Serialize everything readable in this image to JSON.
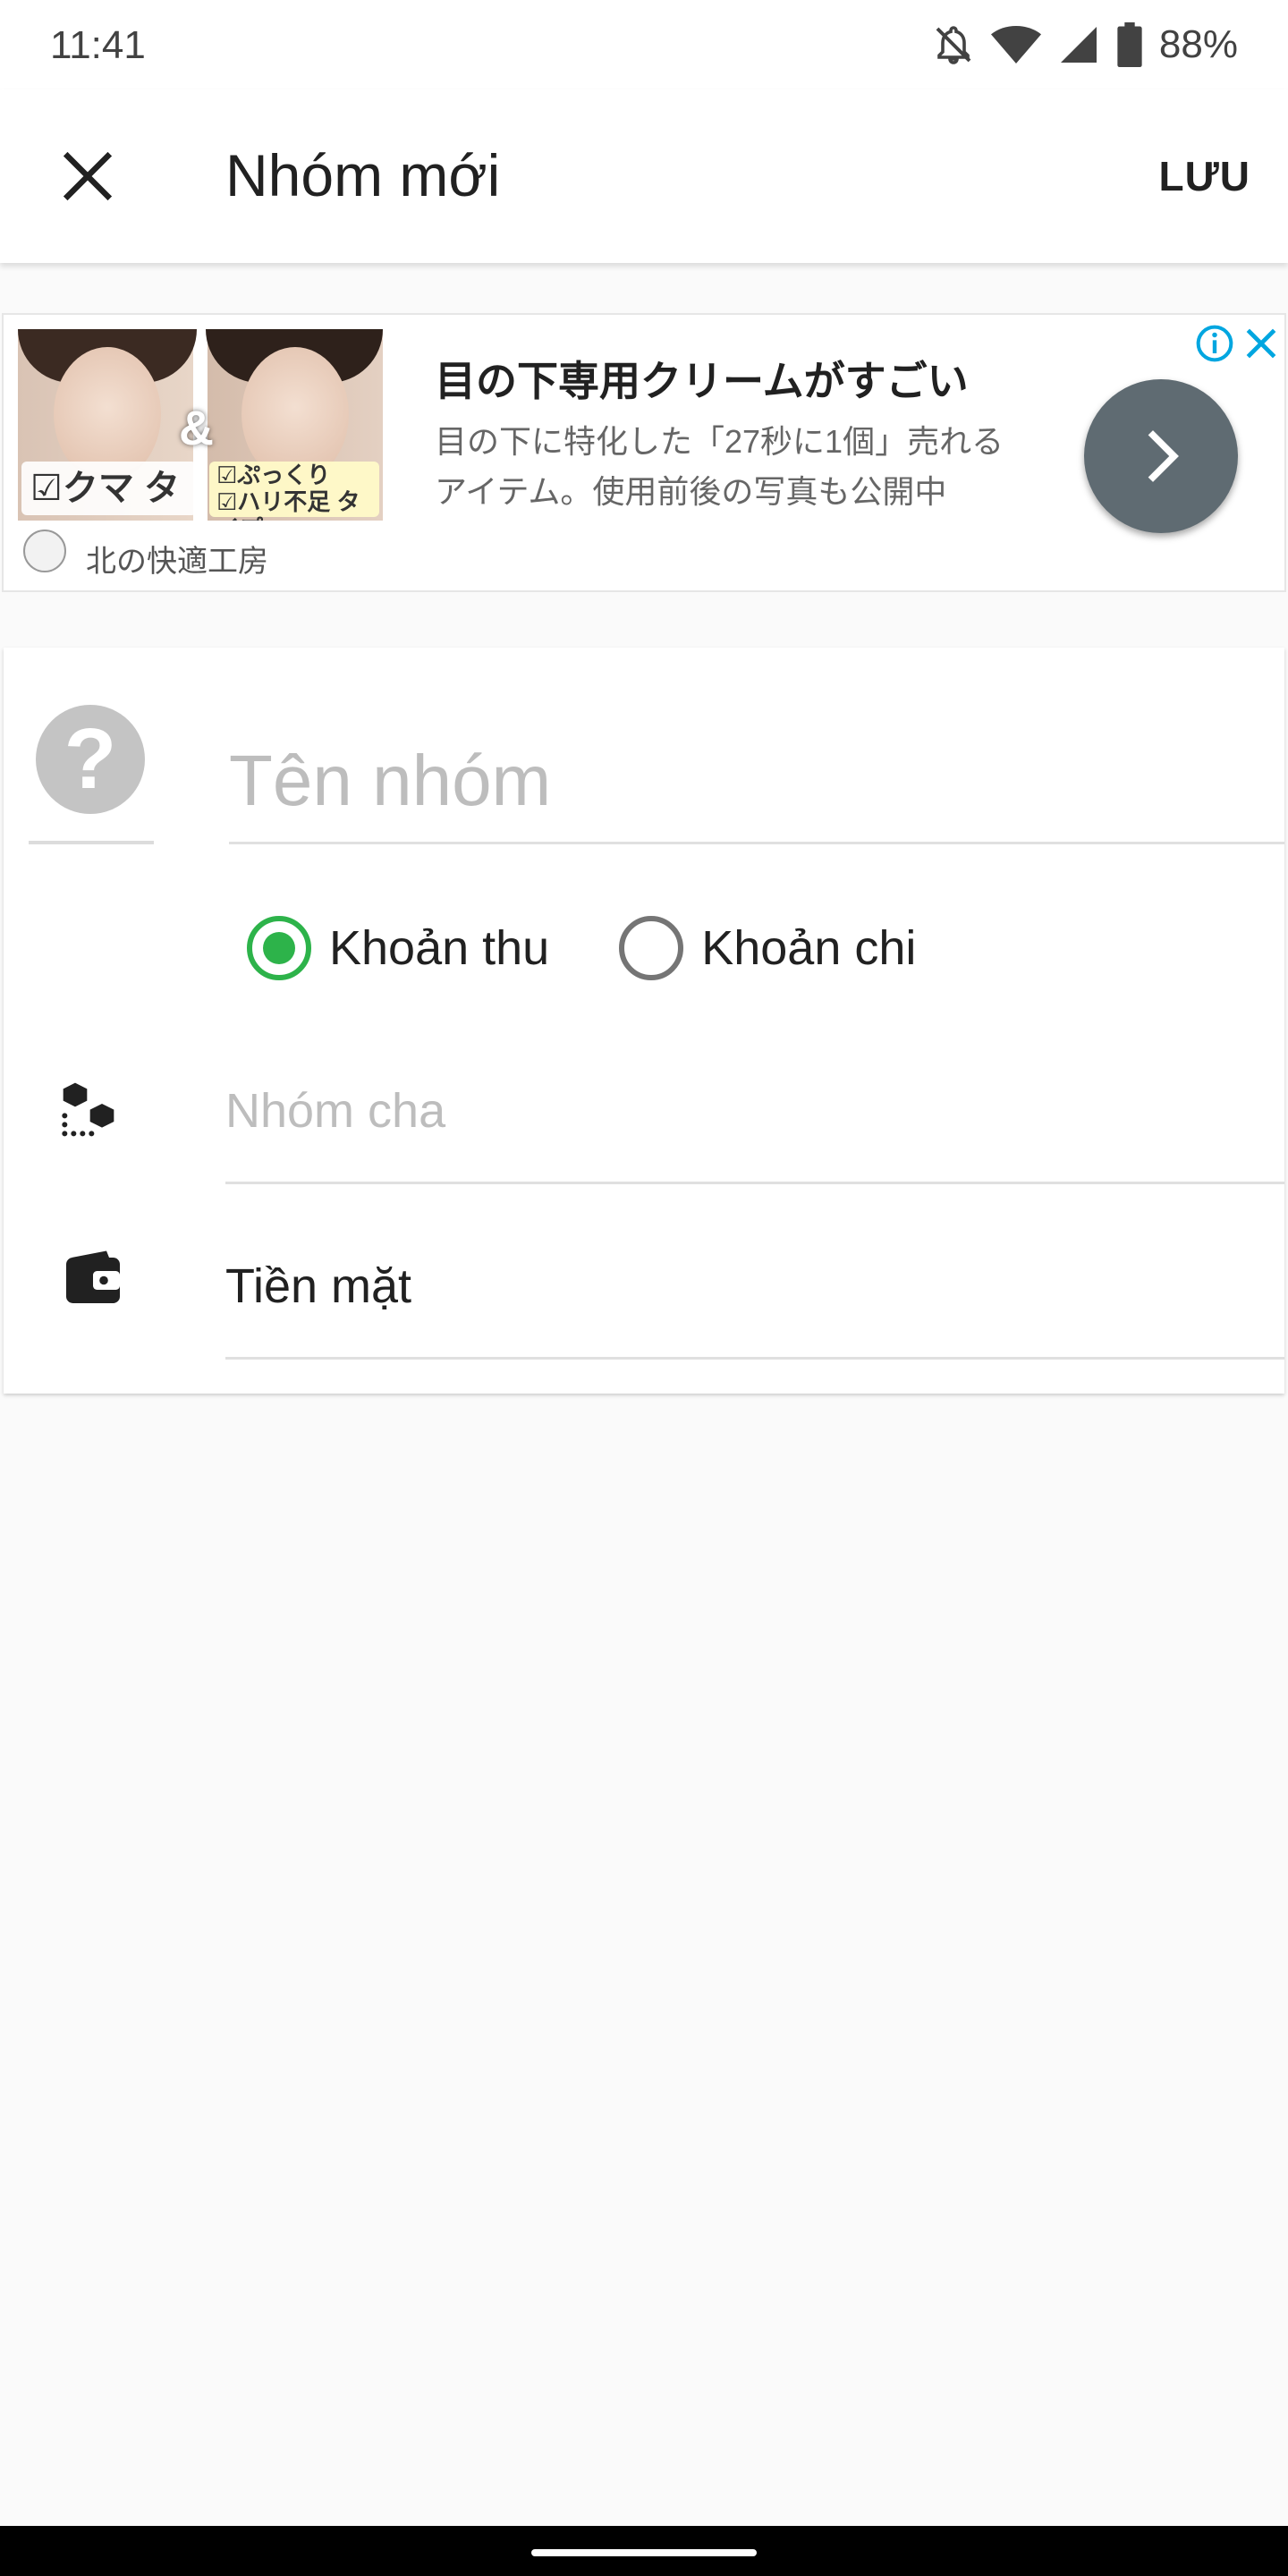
{
  "status_bar": {
    "time": "11:41",
    "battery": "88%",
    "icons": [
      "bell-off-icon",
      "wifi-icon",
      "signal-icon",
      "battery-icon"
    ]
  },
  "app_bar": {
    "title": "Nhóm mới",
    "save_label": "LƯU",
    "close_icon": "close-icon"
  },
  "ad": {
    "title": "目の下専用クリームがすごい",
    "description": "目の下に特化した「27秒に1個」売れるアイテム。使用前後の写真も公開中",
    "brand": "北の快適工房",
    "image_ampersand": "&",
    "image_tag_left": "☑クマ タイプ",
    "image_tag_right_line1": "☑ぷっくり",
    "image_tag_right_line2": "☑ハリ不足 タイプ",
    "info_icon": "info-icon",
    "close_icon": "close-icon",
    "arrow_icon": "chevron-right-icon"
  },
  "form": {
    "icon_placeholder": "?",
    "name_placeholder": "Tên nhóm",
    "name_value": "",
    "type_options": [
      {
        "label": "Khoản thu",
        "checked": true
      },
      {
        "label": "Khoản chi",
        "checked": false
      }
    ],
    "parent_group_placeholder": "Nhóm cha",
    "wallet_value": "Tiền mặt"
  },
  "colors": {
    "accent_green": "#2db34a",
    "ad_arrow_bg": "#5f6b72",
    "ad_info_blue": "#00a6e0",
    "placeholder_gray": "#bdbdbd"
  }
}
